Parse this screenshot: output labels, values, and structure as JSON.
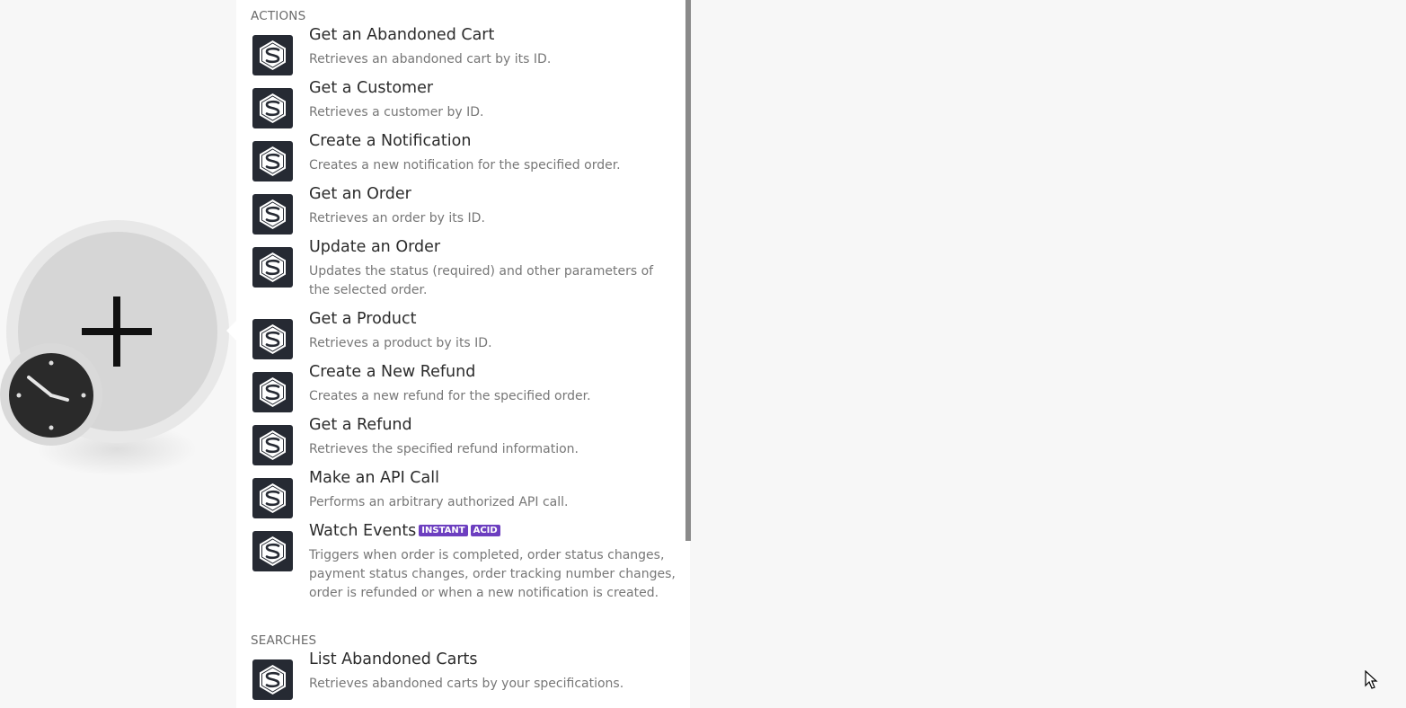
{
  "colors": {
    "logo_bg": "#262a33",
    "badge_bg": "#6d3fc0",
    "panel_bg": "#ffffff",
    "canvas_bg": "#f7f7f7"
  },
  "canvas": {
    "module_icon": "plus-icon",
    "trigger_icon": "clock-icon"
  },
  "actions_header": "ACTIONS",
  "actions": [
    {
      "title": "Get an Abandoned Cart",
      "desc": "Retrieves an abandoned cart by its ID."
    },
    {
      "title": "Get a Customer",
      "desc": "Retrieves a customer by ID."
    },
    {
      "title": "Create a Notification",
      "desc": "Creates a new notification for the specified order."
    },
    {
      "title": "Get an Order",
      "desc": "Retrieves an order by its ID."
    },
    {
      "title": "Update an Order",
      "desc": "Updates the status (required) and other parameters of the selected order."
    },
    {
      "title": "Get a Product",
      "desc": "Retrieves a product by its ID."
    },
    {
      "title": "Create a New Refund",
      "desc": "Creates a new refund for the specified order."
    },
    {
      "title": "Get a Refund",
      "desc": "Retrieves the specified refund information."
    },
    {
      "title": "Make an API Call",
      "desc": "Performs an arbitrary authorized API call."
    },
    {
      "title": "Watch Events",
      "badges": [
        "INSTANT",
        "ACID"
      ],
      "desc": "Triggers when order is completed, order status changes, payment status changes, order tracking number changes, order is refunded or when a new notification is created."
    }
  ],
  "searches_header": "SEARCHES",
  "searches": [
    {
      "title": "List Abandoned Carts",
      "desc": "Retrieves abandoned carts by your specifications."
    }
  ]
}
